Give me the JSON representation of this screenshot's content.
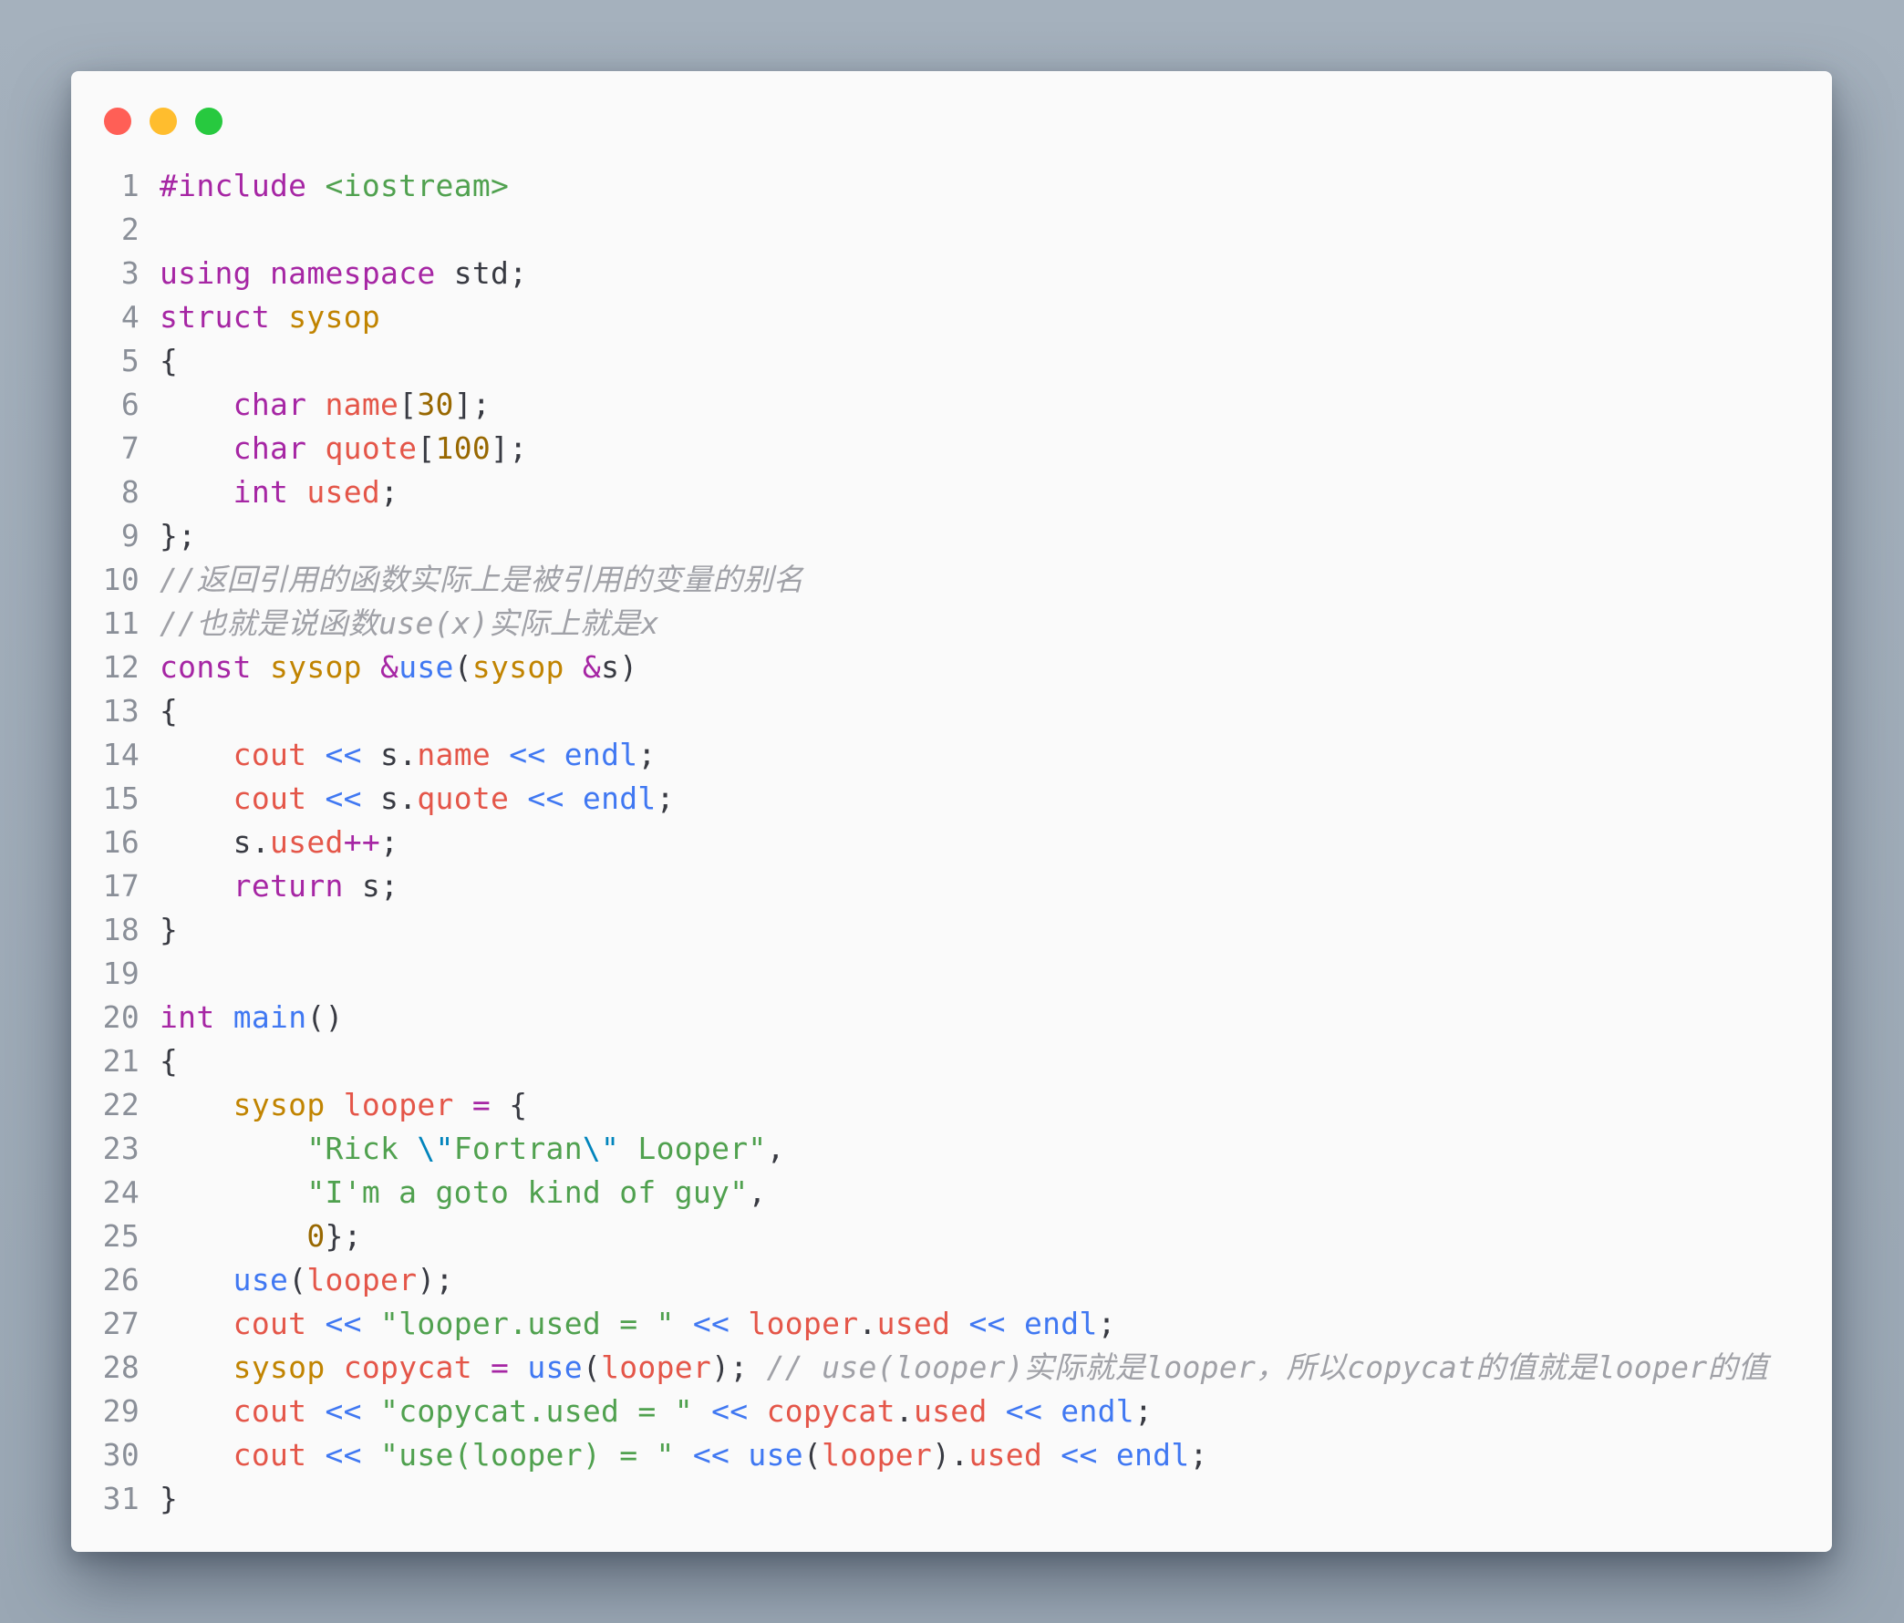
{
  "window": {
    "controls": [
      {
        "name": "close",
        "color": "#ff5f56"
      },
      {
        "name": "minimize",
        "color": "#ffbd2e"
      },
      {
        "name": "zoom",
        "color": "#27c93f"
      }
    ]
  },
  "code": {
    "language": "cpp",
    "colors": {
      "keyword": "#a626a4",
      "type": "#c18401",
      "number": "#986801",
      "string": "#50a14f",
      "function": "#4078f2",
      "variable": "#e45649",
      "comment": "#a0a1a7",
      "text": "#383a42",
      "line_number": "#8a8f98"
    },
    "lines": [
      {
        "n": "1",
        "tokens": [
          [
            "kw",
            "#include"
          ],
          [
            "p",
            " "
          ],
          [
            "str",
            "<iostream>"
          ]
        ]
      },
      {
        "n": "2",
        "tokens": []
      },
      {
        "n": "3",
        "tokens": [
          [
            "kw",
            "using"
          ],
          [
            "p",
            " "
          ],
          [
            "kw",
            "namespace"
          ],
          [
            "p",
            " std;"
          ]
        ]
      },
      {
        "n": "4",
        "tokens": [
          [
            "kw",
            "struct"
          ],
          [
            "p",
            " "
          ],
          [
            "type",
            "sysop"
          ]
        ]
      },
      {
        "n": "5",
        "tokens": [
          [
            "p",
            "{"
          ]
        ]
      },
      {
        "n": "6",
        "tokens": [
          [
            "p",
            "    "
          ],
          [
            "kw",
            "char"
          ],
          [
            "p",
            " "
          ],
          [
            "var",
            "name"
          ],
          [
            "p",
            "["
          ],
          [
            "num",
            "30"
          ],
          [
            "p",
            "];"
          ]
        ]
      },
      {
        "n": "7",
        "tokens": [
          [
            "p",
            "    "
          ],
          [
            "kw",
            "char"
          ],
          [
            "p",
            " "
          ],
          [
            "var",
            "quote"
          ],
          [
            "p",
            "["
          ],
          [
            "num",
            "100"
          ],
          [
            "p",
            "];"
          ]
        ]
      },
      {
        "n": "8",
        "tokens": [
          [
            "p",
            "    "
          ],
          [
            "kw",
            "int"
          ],
          [
            "p",
            " "
          ],
          [
            "var",
            "used"
          ],
          [
            "p",
            ";"
          ]
        ]
      },
      {
        "n": "9",
        "tokens": [
          [
            "p",
            "};"
          ]
        ]
      },
      {
        "n": "10",
        "tokens": [
          [
            "com",
            "//返回引用的函数实际上是被引用的变量的别名"
          ]
        ]
      },
      {
        "n": "11",
        "tokens": [
          [
            "com",
            "//也就是说函数use(x)实际上就是x"
          ]
        ]
      },
      {
        "n": "12",
        "tokens": [
          [
            "kw",
            "const"
          ],
          [
            "p",
            " "
          ],
          [
            "type",
            "sysop"
          ],
          [
            "p",
            " "
          ],
          [
            "kw",
            "&"
          ],
          [
            "fn",
            "use"
          ],
          [
            "p",
            "("
          ],
          [
            "type",
            "sysop"
          ],
          [
            "p",
            " "
          ],
          [
            "kw",
            "&"
          ],
          [
            "p",
            "s)"
          ]
        ]
      },
      {
        "n": "13",
        "tokens": [
          [
            "p",
            "{"
          ]
        ]
      },
      {
        "n": "14",
        "tokens": [
          [
            "p",
            "    "
          ],
          [
            "var",
            "cout"
          ],
          [
            "p",
            " "
          ],
          [
            "op",
            "<<"
          ],
          [
            "p",
            " s."
          ],
          [
            "var",
            "name"
          ],
          [
            "p",
            " "
          ],
          [
            "op",
            "<<"
          ],
          [
            "p",
            " "
          ],
          [
            "fn",
            "endl"
          ],
          [
            "p",
            ";"
          ]
        ]
      },
      {
        "n": "15",
        "tokens": [
          [
            "p",
            "    "
          ],
          [
            "var",
            "cout"
          ],
          [
            "p",
            " "
          ],
          [
            "op",
            "<<"
          ],
          [
            "p",
            " s."
          ],
          [
            "var",
            "quote"
          ],
          [
            "p",
            " "
          ],
          [
            "op",
            "<<"
          ],
          [
            "p",
            " "
          ],
          [
            "fn",
            "endl"
          ],
          [
            "p",
            ";"
          ]
        ]
      },
      {
        "n": "16",
        "tokens": [
          [
            "p",
            "    s."
          ],
          [
            "var",
            "used"
          ],
          [
            "kw",
            "++"
          ],
          [
            "p",
            ";"
          ]
        ]
      },
      {
        "n": "17",
        "tokens": [
          [
            "p",
            "    "
          ],
          [
            "kw",
            "return"
          ],
          [
            "p",
            " s;"
          ]
        ]
      },
      {
        "n": "18",
        "tokens": [
          [
            "p",
            "}"
          ]
        ]
      },
      {
        "n": "19",
        "tokens": []
      },
      {
        "n": "20",
        "tokens": [
          [
            "kw",
            "int"
          ],
          [
            "p",
            " "
          ],
          [
            "fn",
            "main"
          ],
          [
            "p",
            "()"
          ]
        ]
      },
      {
        "n": "21",
        "tokens": [
          [
            "p",
            "{"
          ]
        ]
      },
      {
        "n": "22",
        "tokens": [
          [
            "p",
            "    "
          ],
          [
            "type",
            "sysop"
          ],
          [
            "p",
            " "
          ],
          [
            "var",
            "looper"
          ],
          [
            "p",
            " "
          ],
          [
            "kw",
            "="
          ],
          [
            "p",
            " {"
          ]
        ]
      },
      {
        "n": "23",
        "tokens": [
          [
            "p",
            "        "
          ],
          [
            "str",
            "\"Rick "
          ],
          [
            "esc",
            "\\\""
          ],
          [
            "str",
            "Fortran"
          ],
          [
            "esc",
            "\\\""
          ],
          [
            "str",
            " Looper\""
          ],
          [
            "p",
            ","
          ]
        ]
      },
      {
        "n": "24",
        "tokens": [
          [
            "p",
            "        "
          ],
          [
            "str",
            "\"I'm a goto kind of guy\""
          ],
          [
            "p",
            ","
          ]
        ]
      },
      {
        "n": "25",
        "tokens": [
          [
            "p",
            "        "
          ],
          [
            "num",
            "0"
          ],
          [
            "p",
            "};"
          ]
        ]
      },
      {
        "n": "26",
        "tokens": [
          [
            "p",
            "    "
          ],
          [
            "fn",
            "use"
          ],
          [
            "p",
            "("
          ],
          [
            "var",
            "looper"
          ],
          [
            "p",
            ");"
          ]
        ]
      },
      {
        "n": "27",
        "tokens": [
          [
            "p",
            "    "
          ],
          [
            "var",
            "cout"
          ],
          [
            "p",
            " "
          ],
          [
            "op",
            "<<"
          ],
          [
            "p",
            " "
          ],
          [
            "str",
            "\"looper.used = \""
          ],
          [
            "p",
            " "
          ],
          [
            "op",
            "<<"
          ],
          [
            "p",
            " "
          ],
          [
            "var",
            "looper"
          ],
          [
            "p",
            "."
          ],
          [
            "var",
            "used"
          ],
          [
            "p",
            " "
          ],
          [
            "op",
            "<<"
          ],
          [
            "p",
            " "
          ],
          [
            "fn",
            "endl"
          ],
          [
            "p",
            ";"
          ]
        ]
      },
      {
        "n": "28",
        "tokens": [
          [
            "p",
            "    "
          ],
          [
            "type",
            "sysop"
          ],
          [
            "p",
            " "
          ],
          [
            "var",
            "copycat"
          ],
          [
            "p",
            " "
          ],
          [
            "kw",
            "="
          ],
          [
            "p",
            " "
          ],
          [
            "fn",
            "use"
          ],
          [
            "p",
            "("
          ],
          [
            "var",
            "looper"
          ],
          [
            "p",
            "); "
          ],
          [
            "com",
            "// use(looper)实际就是looper，所以copycat的值就是looper的值"
          ]
        ]
      },
      {
        "n": "29",
        "tokens": [
          [
            "p",
            "    "
          ],
          [
            "var",
            "cout"
          ],
          [
            "p",
            " "
          ],
          [
            "op",
            "<<"
          ],
          [
            "p",
            " "
          ],
          [
            "str",
            "\"copycat.used = \""
          ],
          [
            "p",
            " "
          ],
          [
            "op",
            "<<"
          ],
          [
            "p",
            " "
          ],
          [
            "var",
            "copycat"
          ],
          [
            "p",
            "."
          ],
          [
            "var",
            "used"
          ],
          [
            "p",
            " "
          ],
          [
            "op",
            "<<"
          ],
          [
            "p",
            " "
          ],
          [
            "fn",
            "endl"
          ],
          [
            "p",
            ";"
          ]
        ]
      },
      {
        "n": "30",
        "tokens": [
          [
            "p",
            "    "
          ],
          [
            "var",
            "cout"
          ],
          [
            "p",
            " "
          ],
          [
            "op",
            "<<"
          ],
          [
            "p",
            " "
          ],
          [
            "str",
            "\"use(looper) = \""
          ],
          [
            "p",
            " "
          ],
          [
            "op",
            "<<"
          ],
          [
            "p",
            " "
          ],
          [
            "fn",
            "use"
          ],
          [
            "p",
            "("
          ],
          [
            "var",
            "looper"
          ],
          [
            "p",
            ")."
          ],
          [
            "var",
            "used"
          ],
          [
            "p",
            " "
          ],
          [
            "op",
            "<<"
          ],
          [
            "p",
            " "
          ],
          [
            "fn",
            "endl"
          ],
          [
            "p",
            ";"
          ]
        ]
      },
      {
        "n": "31",
        "tokens": [
          [
            "p",
            "}"
          ]
        ]
      }
    ]
  }
}
